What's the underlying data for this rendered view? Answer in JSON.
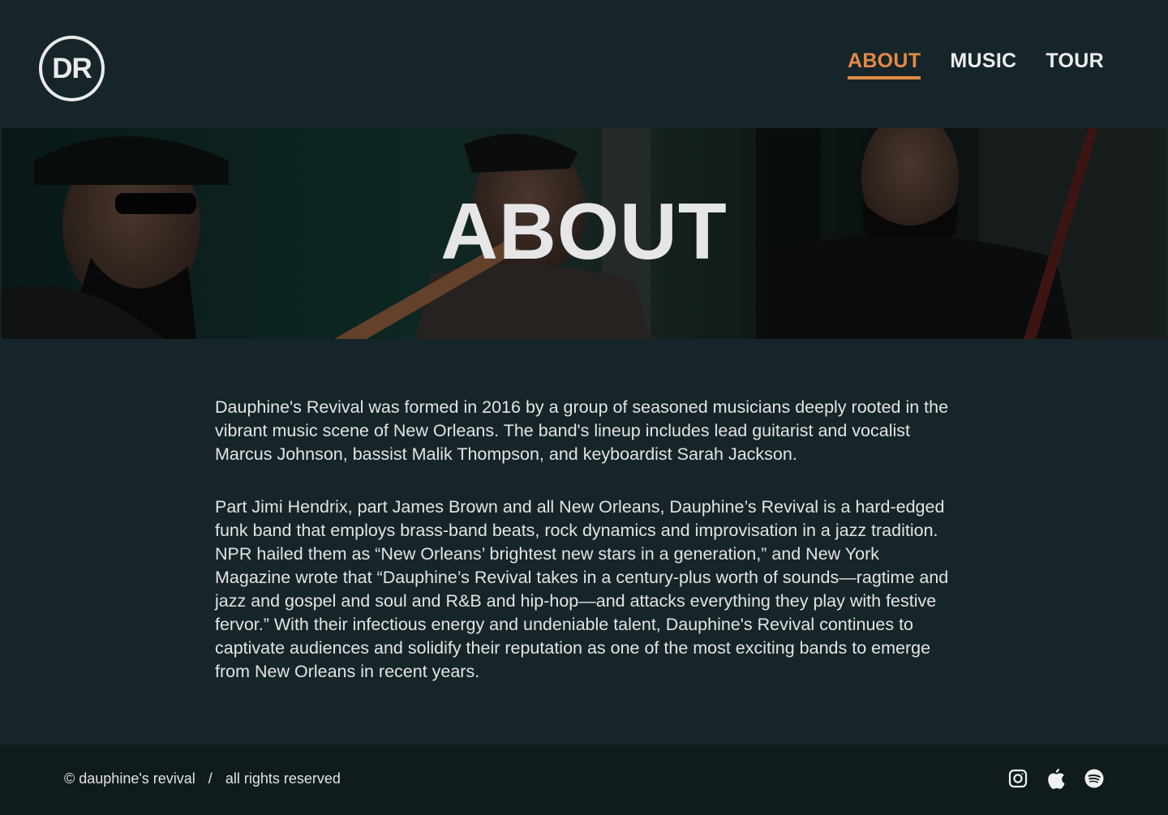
{
  "brand": {
    "logo_text": "DR"
  },
  "nav": {
    "items": [
      {
        "label": "ABOUT",
        "active": true
      },
      {
        "label": "MUSIC",
        "active": false
      },
      {
        "label": "TOUR",
        "active": false
      }
    ]
  },
  "hero": {
    "title": "ABOUT"
  },
  "about": {
    "paragraphs": [
      "Dauphine's Revival was formed in 2016 by a group of seasoned musicians deeply rooted in the vibrant music scene of New Orleans. The band's lineup includes lead guitarist and vocalist Marcus Johnson, bassist Malik Thompson, and keyboardist Sarah Jackson.",
      "Part Jimi Hendrix, part James Brown and all New Orleans, Dauphine’s Revival is a hard-edged funk band that employs brass-band beats, rock dynamics and improvisation in a jazz tradition. NPR hailed them as “New Orleans’ brightest new stars in a generation,” and New York Magazine wrote that “Dauphine’s Revival takes in a century-plus worth of sounds—ragtime and jazz and gospel and soul and R&B and hip-hop—and attacks everything they play with festive fervor.” With their infectious energy and undeniable talent, Dauphine's Revival continues to captivate audiences and solidify their reputation as one of the most exciting bands to emerge from New Orleans in recent years."
    ]
  },
  "footer": {
    "copyright": "© dauphine's revival",
    "separator": "/",
    "rights": "all rights reserved",
    "socials": [
      "instagram-icon",
      "apple-icon",
      "spotify-icon"
    ]
  },
  "colors": {
    "background": "#16252a",
    "footer_background": "#101b1e",
    "accent": "#e38a45",
    "text": "#e9e9e6"
  }
}
